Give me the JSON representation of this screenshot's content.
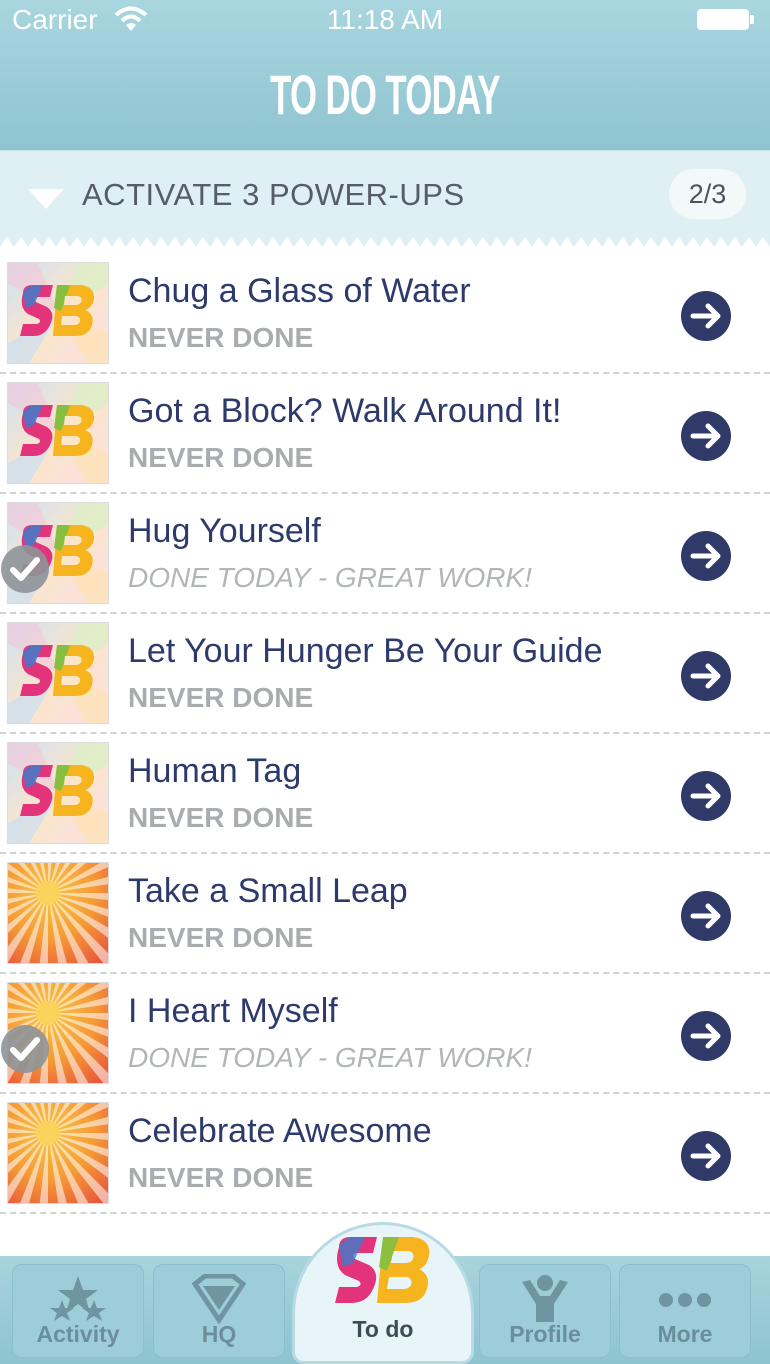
{
  "status_bar": {
    "carrier": "Carrier",
    "time": "11:18 AM"
  },
  "header": {
    "title": "TO DO TODAY"
  },
  "section": {
    "title": "ACTIVATE 3 POWER-UPS",
    "progress": "2/3",
    "expanded": true
  },
  "tasks": [
    {
      "title": "Chug a Glass of Water",
      "status": "NEVER DONE",
      "done": false,
      "thumb": "sb-logo"
    },
    {
      "title": "Got a Block? Walk Around It!",
      "status": "NEVER DONE",
      "done": false,
      "thumb": "sb-logo"
    },
    {
      "title": "Hug Yourself",
      "status": "DONE TODAY - GREAT WORK!",
      "done": true,
      "thumb": "sb-logo"
    },
    {
      "title": "Let Your Hunger Be Your Guide",
      "status": "NEVER DONE",
      "done": false,
      "thumb": "sb-logo"
    },
    {
      "title": "Human Tag",
      "status": "NEVER DONE",
      "done": false,
      "thumb": "sb-logo"
    },
    {
      "title": "Take a Small Leap",
      "status": "NEVER DONE",
      "done": false,
      "thumb": "sunburst"
    },
    {
      "title": "I Heart Myself",
      "status": "DONE TODAY - GREAT WORK!",
      "done": true,
      "thumb": "sunburst"
    },
    {
      "title": "Celebrate Awesome",
      "status": "NEVER DONE",
      "done": false,
      "thumb": "sunburst"
    }
  ],
  "tabbar": {
    "activity": "Activity",
    "hq": "HQ",
    "todo": "To do",
    "profile": "Profile",
    "more": "More",
    "selected": "To do"
  },
  "colors": {
    "header": "#9ccbd6",
    "title_text": "#2e3a6b",
    "status_text": "#a9adb0",
    "go_button": "#2f3a68"
  }
}
